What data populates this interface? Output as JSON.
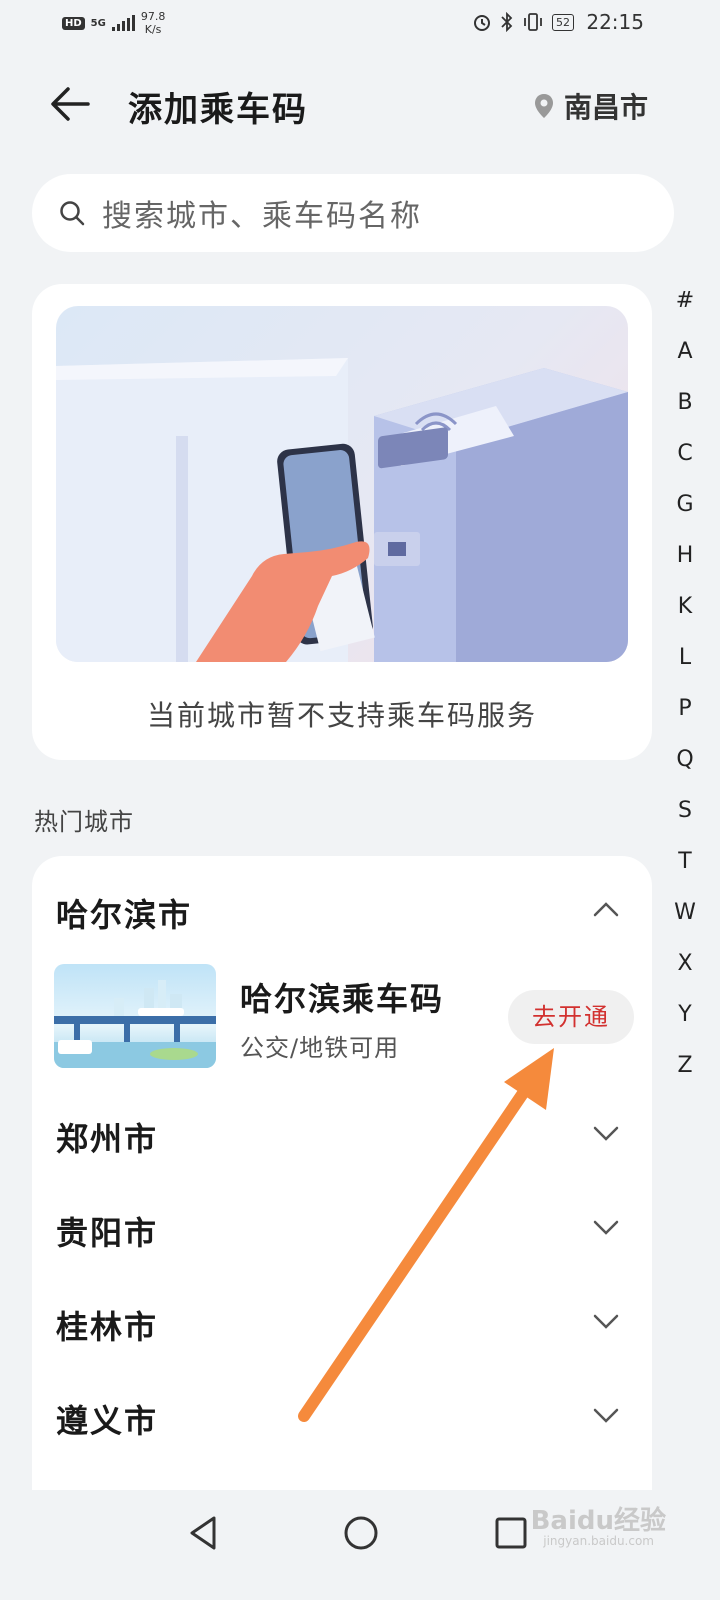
{
  "status_bar": {
    "network_badge": "HD",
    "network_type": "5G",
    "speed_value": "97.8",
    "speed_unit": "K/s",
    "battery": "52",
    "time": "22:15"
  },
  "header": {
    "title": "添加乘车码",
    "location": "南昌市"
  },
  "search": {
    "placeholder": "搜索城市、乘车码名称"
  },
  "banner": {
    "caption": "当前城市暂不支持乘车码服务"
  },
  "index_letters": [
    "#",
    "A",
    "B",
    "C",
    "G",
    "H",
    "K",
    "L",
    "P",
    "Q",
    "S",
    "T",
    "W",
    "X",
    "Y",
    "Z"
  ],
  "hot_cities": {
    "label": "热门城市",
    "cities": [
      {
        "name": "哈尔滨市",
        "expanded": true
      },
      {
        "name": "郑州市",
        "expanded": false
      },
      {
        "name": "贵阳市",
        "expanded": false
      },
      {
        "name": "桂林市",
        "expanded": false
      },
      {
        "name": "遵义市",
        "expanded": false
      }
    ],
    "expanded_item": {
      "title": "哈尔滨乘车码",
      "subtitle": "公交/地铁可用",
      "button": "去开通"
    }
  },
  "watermark": {
    "brand": "Baidu经验",
    "url": "jingyan.baidu.com"
  },
  "colors": {
    "accent_red": "#d2312f",
    "annotation_arrow": "#f58a3c",
    "background": "#f1f3f5"
  }
}
